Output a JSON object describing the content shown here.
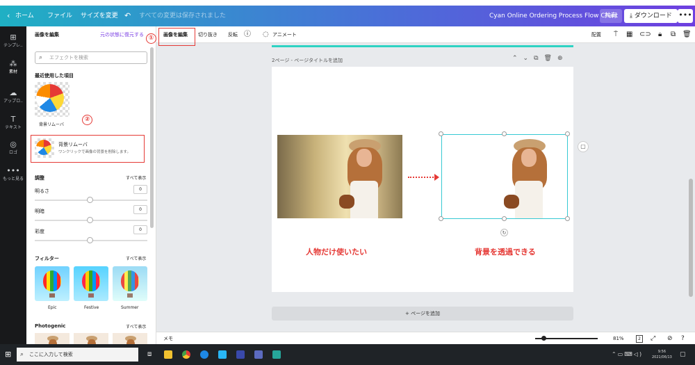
{
  "topbar": {
    "home": "ホーム",
    "file": "ファイル",
    "resize": "サイズを変更",
    "saved_status": "すべての変更は保存されました",
    "doc_title": "Cyan Online Ordering Process Flow Chart",
    "share": "共有",
    "download": "ダウンロード",
    "more": "•••"
  },
  "rail": {
    "items": [
      {
        "label": "テンプレ..",
        "icon": "template-icon"
      },
      {
        "label": "素材",
        "icon": "elements-icon"
      },
      {
        "label": "アップロ..",
        "icon": "upload-icon"
      },
      {
        "label": "テキスト",
        "icon": "text-icon"
      },
      {
        "label": "ロゴ",
        "icon": "logo-icon"
      },
      {
        "label": "もっと見る",
        "icon": "more-icon"
      }
    ]
  },
  "panel": {
    "title": "画像を編集",
    "restore": "元の状態に復元する",
    "search_placeholder": "エフェクトを検索",
    "recent_heading": "最近使用した項目",
    "recent_item_label": "背景リムーバ",
    "bg_remover": {
      "title": "背景リムーバ",
      "desc": "ワンクリックで画像の背景を削除します。"
    },
    "adjust": {
      "heading": "調整",
      "show_all": "すべて表示",
      "sliders": [
        {
          "label": "明るさ",
          "value": "0"
        },
        {
          "label": "明暗",
          "value": "0"
        },
        {
          "label": "彩度",
          "value": "0"
        }
      ]
    },
    "filters": {
      "heading": "フィルター",
      "show_all": "すべて表示",
      "items": [
        "Epic",
        "Festive",
        "Summer"
      ]
    },
    "photogenic": {
      "heading": "Photogenic",
      "show_all": "すべて表示"
    }
  },
  "toolbar2": {
    "edit_image": "画像を編集",
    "crop": "切り抜き",
    "flip": "反転",
    "info": "ⓘ",
    "animate": "アニメート",
    "arrange": "配置"
  },
  "canvas": {
    "page_label": "2ページ - ページタイトルを追加",
    "caption_left": "人物だけ使いたい",
    "caption_right": "背景を透過できる",
    "add_page": "+ ページを追加"
  },
  "statusbar": {
    "memo": "メモ",
    "zoom": "81%",
    "page_count": "2"
  },
  "annotations": {
    "one": "①",
    "two": "②"
  },
  "taskbar": {
    "search_placeholder": "ここに入力して検索",
    "time": "9:56",
    "date": "2021/06/13"
  },
  "colors": {
    "accent_teal": "#2ed3c3",
    "annotation_red": "#e53935",
    "selection": "#36c9d3"
  }
}
